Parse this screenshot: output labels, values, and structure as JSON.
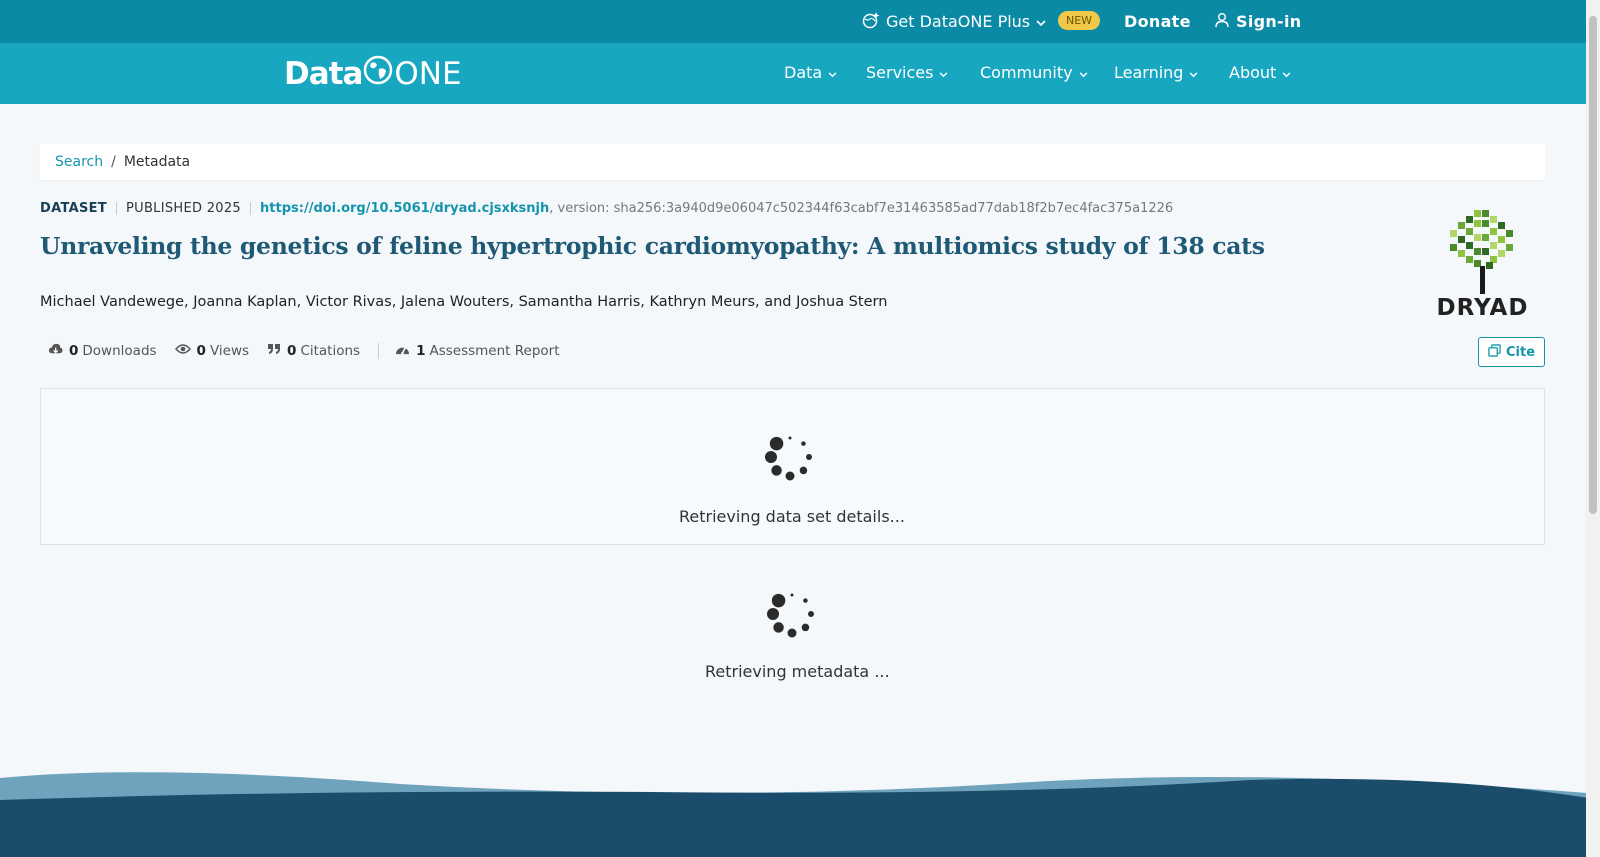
{
  "topbar": {
    "plus_label": "Get DataONE Plus",
    "new_badge": "NEW",
    "donate_label": "Donate",
    "signin_label": "Sign-in"
  },
  "logo": {
    "part1": "Data",
    "part2": "ONE"
  },
  "nav": {
    "items": [
      {
        "label": "Data"
      },
      {
        "label": "Services"
      },
      {
        "label": "Community"
      },
      {
        "label": "Learning"
      },
      {
        "label": "About"
      }
    ]
  },
  "breadcrumb": {
    "search": "Search",
    "separator": "/",
    "current": "Metadata"
  },
  "dataset": {
    "type": "DATASET",
    "published": "PUBLISHED 2025",
    "doi": "https://doi.org/10.5061/dryad.cjsxksnjh",
    "version": ", version: sha256:3a940d9e06047c502344f63cabf7e31463585ad77dab18f2b7ec4fac375a1226",
    "title": "Unraveling the genetics of feline hypertrophic cardiomyopathy: A multiomics study of 138 cats",
    "authors": "Michael Vandewege, Joanna Kaplan, Victor Rivas, Jalena Wouters, Samantha Harris, Kathryn Meurs, and Joshua Stern"
  },
  "repository": {
    "name": "DRYAD"
  },
  "metrics": {
    "downloads_count": "0",
    "downloads_label": "Downloads",
    "views_count": "0",
    "views_label": "Views",
    "citations_count": "0",
    "citations_label": "Citations",
    "assessment_count": "1",
    "assessment_label": "Assessment Report"
  },
  "cite_label": "Cite",
  "loading": {
    "details": "Retrieving data set details...",
    "metadata": "Retrieving metadata ..."
  },
  "colors": {
    "topbar": "#0b8aa5",
    "nav": "#18a7c0",
    "accent": "#1595ad",
    "title": "#1e5a76",
    "badge": "#f0c94a"
  }
}
